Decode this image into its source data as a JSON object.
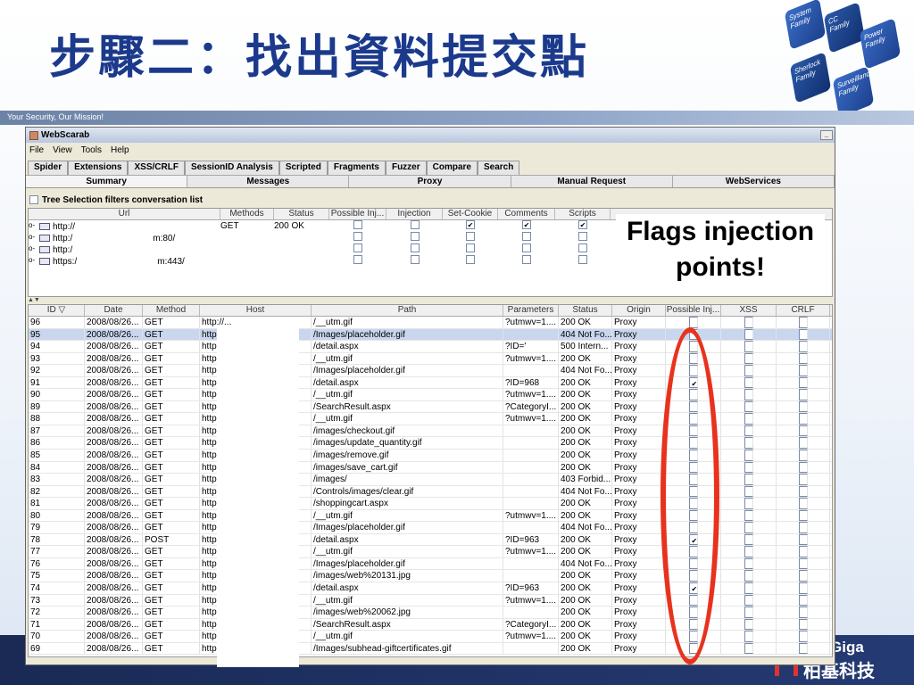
{
  "slide": {
    "title": "步驟二：找出資料提交點",
    "tagline": "Your Security, Our Mission!",
    "tiles": [
      "System Family",
      "CC Family",
      "Power Family",
      "Sherlock Family",
      "Surveillance Family"
    ],
    "brand": "Giga",
    "brand_cn": "柏基科技",
    "callout": "Flags injection points!",
    "colors": {
      "title": "#1c3a8c",
      "oval": "#e8321e",
      "band": "#1a2a55"
    }
  },
  "window": {
    "title": "WebScarab",
    "menus": [
      "File",
      "View",
      "Tools",
      "Help"
    ],
    "tabs_row1": [
      "Spider",
      "Extensions",
      "XSS/CRLF",
      "SessionID Analysis",
      "Scripted",
      "Fragments",
      "Fuzzer",
      "Compare",
      "Search"
    ],
    "tabs_row2": [
      "Summary",
      "Messages",
      "Proxy",
      "Manual Request",
      "WebServices"
    ],
    "filter_label": "Tree Selection filters conversation list",
    "tree": {
      "columns": [
        "Url",
        "Methods",
        "Status",
        "Possible Inj...",
        "Injection",
        "Set-Cookie",
        "Comments",
        "Scripts"
      ],
      "rows": [
        {
          "url": "http://",
          "suffix": "",
          "method": "GET",
          "status": "200 OK",
          "checks": [
            false,
            false,
            true,
            true,
            true
          ]
        },
        {
          "url": "http:/",
          "suffix": "m:80/",
          "method": "",
          "status": "",
          "checks": [
            false,
            false,
            false,
            false,
            false
          ]
        },
        {
          "url": "http:/",
          "suffix": "",
          "method": "",
          "status": "",
          "checks": [
            false,
            false,
            false,
            false,
            false
          ]
        },
        {
          "url": "https:/",
          "suffix": "m:443/",
          "method": "",
          "status": "",
          "checks": [
            false,
            false,
            false,
            false,
            false
          ]
        }
      ]
    },
    "splitter": "▲▼",
    "grid": {
      "columns": [
        "ID ▽",
        "Date",
        "Method",
        "Host",
        "Path",
        "Parameters",
        "Status",
        "Origin",
        "Possible Inj...",
        "XSS",
        "CRLF"
      ],
      "rows": [
        {
          "id": "96",
          "date": "2008/08/26...",
          "method": "GET",
          "host": "http://...",
          "path": "/__utm.gif",
          "params": "?utmwv=1....",
          "status": "200 OK",
          "origin": "Proxy",
          "inj": false
        },
        {
          "id": "95",
          "date": "2008/08/26...",
          "method": "GET",
          "host": "http:/",
          "path": "/Images/placeholder.gif",
          "params": "",
          "status": "404 Not Fo...",
          "origin": "Proxy",
          "inj": false,
          "sel": true
        },
        {
          "id": "94",
          "date": "2008/08/26...",
          "method": "GET",
          "host": "http:/",
          "path": "/detail.aspx",
          "params": "?ID='",
          "status": "500 Intern...",
          "origin": "Proxy",
          "inj": false
        },
        {
          "id": "93",
          "date": "2008/08/26...",
          "method": "GET",
          "host": "http:/",
          "path": "/__utm.gif",
          "params": "?utmwv=1....",
          "status": "200 OK",
          "origin": "Proxy",
          "inj": false
        },
        {
          "id": "92",
          "date": "2008/08/26...",
          "method": "GET",
          "host": "http:/",
          "path": "/Images/placeholder.gif",
          "params": "",
          "status": "404 Not Fo...",
          "origin": "Proxy",
          "inj": false
        },
        {
          "id": "91",
          "date": "2008/08/26...",
          "method": "GET",
          "host": "http:/",
          "path": "/detail.aspx",
          "params": "?ID=968",
          "status": "200 OK",
          "origin": "Proxy",
          "inj": true
        },
        {
          "id": "90",
          "date": "2008/08/26...",
          "method": "GET",
          "host": "http:/",
          "path": "/__utm.gif",
          "params": "?utmwv=1....",
          "status": "200 OK",
          "origin": "Proxy",
          "inj": false
        },
        {
          "id": "89",
          "date": "2008/08/26...",
          "method": "GET",
          "host": "http:/",
          "path": "/SearchResult.aspx",
          "params": "?CategoryI...",
          "status": "200 OK",
          "origin": "Proxy",
          "inj": false
        },
        {
          "id": "88",
          "date": "2008/08/26...",
          "method": "GET",
          "host": "http:/",
          "path": "/__utm.gif",
          "params": "?utmwv=1....",
          "status": "200 OK",
          "origin": "Proxy",
          "inj": false
        },
        {
          "id": "87",
          "date": "2008/08/26...",
          "method": "GET",
          "host": "http:/",
          "path": "/images/checkout.gif",
          "params": "",
          "status": "200 OK",
          "origin": "Proxy",
          "inj": false
        },
        {
          "id": "86",
          "date": "2008/08/26...",
          "method": "GET",
          "host": "http:/",
          "path": "/images/update_quantity.gif",
          "params": "",
          "status": "200 OK",
          "origin": "Proxy",
          "inj": false
        },
        {
          "id": "85",
          "date": "2008/08/26...",
          "method": "GET",
          "host": "http:/",
          "path": "/images/remove.gif",
          "params": "",
          "status": "200 OK",
          "origin": "Proxy",
          "inj": false
        },
        {
          "id": "84",
          "date": "2008/08/26...",
          "method": "GET",
          "host": "http:/",
          "path": "/images/save_cart.gif",
          "params": "",
          "status": "200 OK",
          "origin": "Proxy",
          "inj": false
        },
        {
          "id": "83",
          "date": "2008/08/26...",
          "method": "GET",
          "host": "http:/",
          "path": "/images/",
          "params": "",
          "status": "403 Forbid...",
          "origin": "Proxy",
          "inj": false
        },
        {
          "id": "82",
          "date": "2008/08/26...",
          "method": "GET",
          "host": "http:/",
          "path": "/Controls/images/clear.gif",
          "params": "",
          "status": "404 Not Fo...",
          "origin": "Proxy",
          "inj": false
        },
        {
          "id": "81",
          "date": "2008/08/26...",
          "method": "GET",
          "host": "http:/",
          "path": "/shoppingcart.aspx",
          "params": "",
          "status": "200 OK",
          "origin": "Proxy",
          "inj": false
        },
        {
          "id": "80",
          "date": "2008/08/26...",
          "method": "GET",
          "host": "http:/",
          "path": "/__utm.gif",
          "params": "?utmwv=1....",
          "status": "200 OK",
          "origin": "Proxy",
          "inj": false
        },
        {
          "id": "79",
          "date": "2008/08/26...",
          "method": "GET",
          "host": "http:/",
          "path": "/Images/placeholder.gif",
          "params": "",
          "status": "404 Not Fo...",
          "origin": "Proxy",
          "inj": false
        },
        {
          "id": "78",
          "date": "2008/08/26...",
          "method": "POST",
          "host": "http:/",
          "path": "/detail.aspx",
          "params": "?ID=963",
          "status": "200 OK",
          "origin": "Proxy",
          "inj": true
        },
        {
          "id": "77",
          "date": "2008/08/26...",
          "method": "GET",
          "host": "http:/",
          "path": "/__utm.gif",
          "params": "?utmwv=1....",
          "status": "200 OK",
          "origin": "Proxy",
          "inj": false
        },
        {
          "id": "76",
          "date": "2008/08/26...",
          "method": "GET",
          "host": "http:/",
          "path": "/Images/placeholder.gif",
          "params": "",
          "status": "404 Not Fo...",
          "origin": "Proxy",
          "inj": false
        },
        {
          "id": "75",
          "date": "2008/08/26...",
          "method": "GET",
          "host": "http:/",
          "path": "/images/web%20131.jpg",
          "params": "",
          "status": "200 OK",
          "origin": "Proxy",
          "inj": false
        },
        {
          "id": "74",
          "date": "2008/08/26...",
          "method": "GET",
          "host": "http:/",
          "path": "/detail.aspx",
          "params": "?ID=963",
          "status": "200 OK",
          "origin": "Proxy",
          "inj": true
        },
        {
          "id": "73",
          "date": "2008/08/26...",
          "method": "GET",
          "host": "http:/",
          "path": "/__utm.gif",
          "params": "?utmwv=1....",
          "status": "200 OK",
          "origin": "Proxy",
          "inj": false
        },
        {
          "id": "72",
          "date": "2008/08/26...",
          "method": "GET",
          "host": "http:/",
          "path": "/images/web%20062.jpg",
          "params": "",
          "status": "200 OK",
          "origin": "Proxy",
          "inj": false
        },
        {
          "id": "71",
          "date": "2008/08/26...",
          "method": "GET",
          "host": "http:/",
          "path": "/SearchResult.aspx",
          "params": "?CategoryI...",
          "status": "200 OK",
          "origin": "Proxy",
          "inj": false
        },
        {
          "id": "70",
          "date": "2008/08/26...",
          "method": "GET",
          "host": "http:/",
          "path": "/__utm.gif",
          "params": "?utmwv=1....",
          "status": "200 OK",
          "origin": "Proxy",
          "inj": false
        },
        {
          "id": "69",
          "date": "2008/08/26...",
          "method": "GET",
          "host": "http://...",
          "path": "/Images/subhead-giftcertificates.gif",
          "params": "",
          "status": "200 OK",
          "origin": "Proxy",
          "inj": false
        }
      ]
    }
  }
}
